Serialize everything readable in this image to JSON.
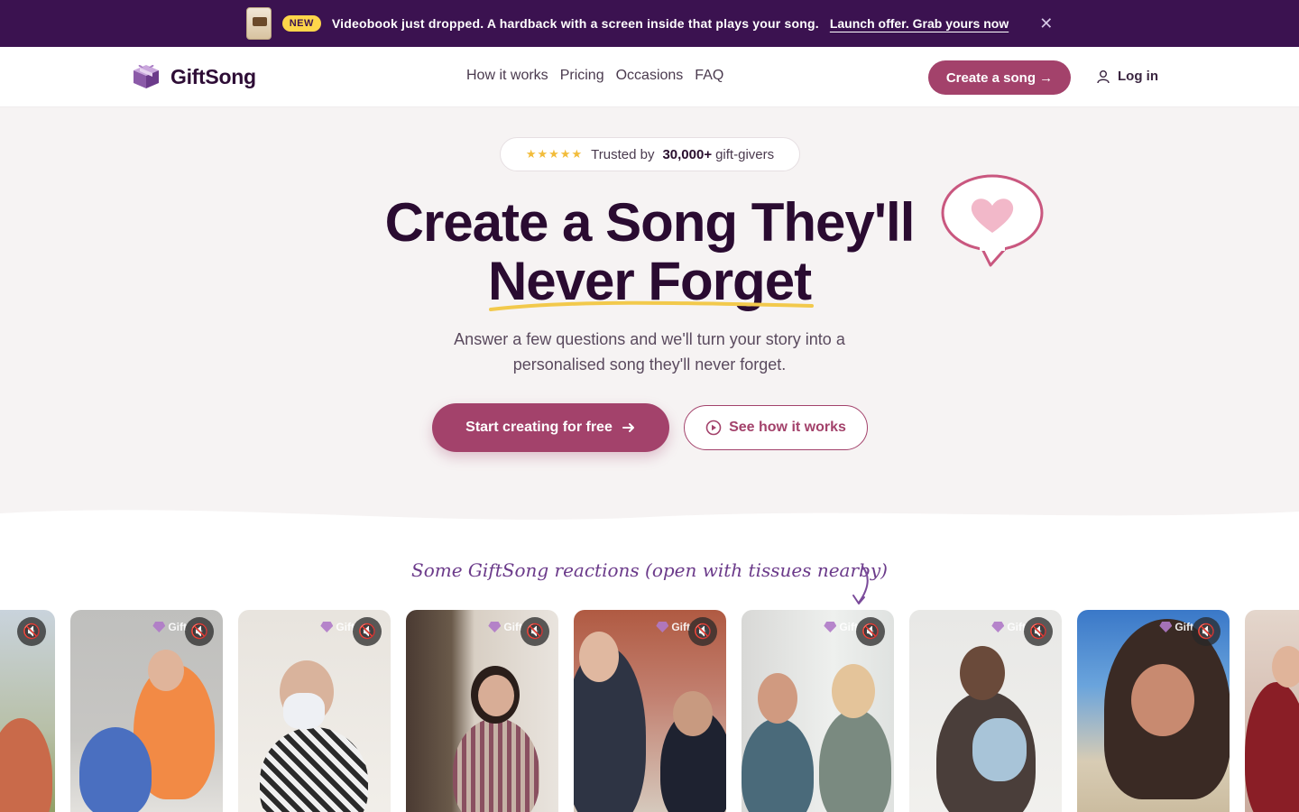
{
  "announcement": {
    "badge": "NEW",
    "message": "Videobook just dropped. A hardback with a screen inside that plays your song.",
    "link": "Launch offer. Grab yours now",
    "close_icon": "close-icon"
  },
  "header": {
    "brand": "GiftSong",
    "nav": [
      "How it works",
      "Pricing",
      "Occasions",
      "FAQ"
    ],
    "cta": "Create a song →",
    "login": "Log in"
  },
  "hero": {
    "stars": "★★★★★",
    "trusted_prefix": "Trusted by",
    "trusted_count": "30,000+",
    "trusted_suffix": "gift-givers",
    "title_line1": "Create a Song They'll",
    "title_line2": "Never Forget",
    "subtitle": "Answer a few questions and we'll turn your story into a personalised song they'll never forget.",
    "primary_cta": "Start creating for free",
    "secondary_cta": "See how it works"
  },
  "reactions": {
    "title": "Some GiftSong reactions (open with tissues nearby)",
    "watermark": "Gift"
  },
  "colors": {
    "brand_plum": "#3b1250",
    "accent_rose": "#a3426b",
    "highlight_yellow": "#ffd64a"
  }
}
